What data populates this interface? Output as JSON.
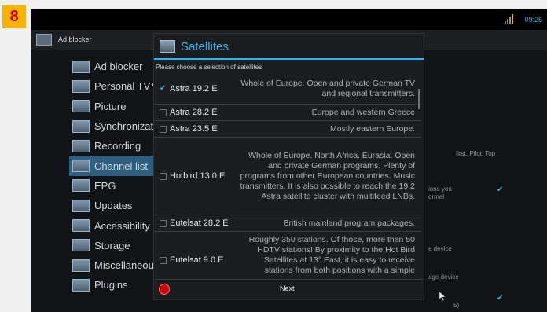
{
  "step_badge": "8",
  "statusbar": {
    "time": "09:25",
    "signal_icon": "signal-icon"
  },
  "appbar": {
    "title": "Ad blocker"
  },
  "menu": {
    "items": [
      {
        "label": "Ad blocker",
        "selected": false
      },
      {
        "label": "Personal TV™",
        "selected": false
      },
      {
        "label": "Picture",
        "selected": false
      },
      {
        "label": "Synchronizati",
        "selected": false
      },
      {
        "label": "Recording",
        "selected": false
      },
      {
        "label": "Channel list",
        "selected": true
      },
      {
        "label": "EPG",
        "selected": false
      },
      {
        "label": "Updates",
        "selected": false
      },
      {
        "label": "Accessibility",
        "selected": false
      },
      {
        "label": "Storage",
        "selected": false
      },
      {
        "label": "Miscellaneous",
        "selected": false
      },
      {
        "label": "Plugins",
        "selected": false
      }
    ]
  },
  "background": {
    "line1": "first. Pilot: Top",
    "line2": "ions you",
    "line3": "ormal",
    "line4": "e device",
    "line5": "age device",
    "line6": "5)"
  },
  "dialog": {
    "title": "Satellites",
    "subtitle": "Please choose a selection of satellites",
    "satellites": [
      {
        "name": "Astra 19.2 E",
        "checked": true,
        "description": "Whole of Europe. Open and private German TV and regional transmitters."
      },
      {
        "name": "Astra 28.2 E",
        "checked": false,
        "description": "Europe and western Greece"
      },
      {
        "name": "Astra 23.5 E",
        "checked": false,
        "description": "Mostly eastern Europe."
      },
      {
        "name": "Hotbird 13.0 E",
        "checked": false,
        "description": "Whole of Europe. North Africa. Eurasia. Open and private German programs. Plenty of programs from other European countries. Music transmitters. It is also possible to reach the 19.2 Astra satellite cluster with multifeed LNBs."
      },
      {
        "name": "Eutelsat 28.2 E",
        "checked": false,
        "description": "British mainland program packages."
      },
      {
        "name": "Eutelsat 9.0 E",
        "checked": false,
        "description": "Roughly 350 stations. Of those, more than 50 HDTV stations! By proximity to the Hot Bird Satellites at 13° East, it is easy to receive stations from both positions with a simple"
      }
    ],
    "next_label": "Next"
  },
  "colors": {
    "accent": "#33b5e5",
    "selected_row": "#2e5f80",
    "badge": "#f4b400",
    "badge_text": "#d10000",
    "record": "#d60000"
  }
}
